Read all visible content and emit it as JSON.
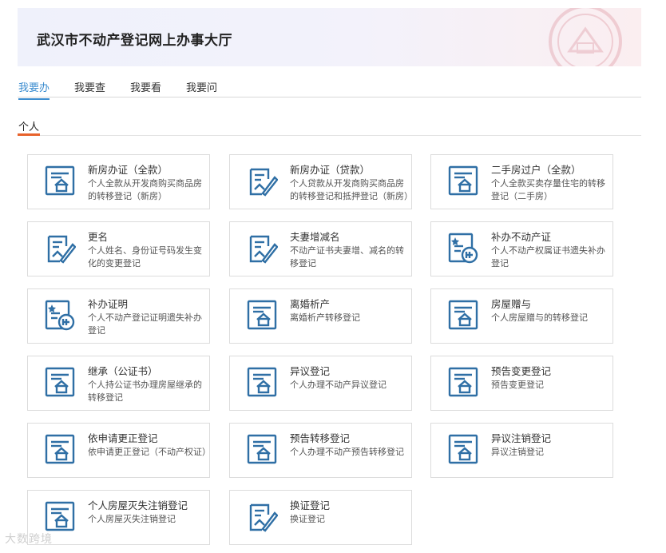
{
  "header": {
    "title": "武汉市不动产登记网上办事大厅"
  },
  "tabs": [
    {
      "label": "我要办",
      "active": true
    },
    {
      "label": "我要查",
      "active": false
    },
    {
      "label": "我要看",
      "active": false
    },
    {
      "label": "我要问",
      "active": false
    }
  ],
  "section": {
    "title": "个人"
  },
  "cards": [
    {
      "title": "新房办证（全款）",
      "desc": "个人全款从开发商购买商品房的转移登记（新房）",
      "icon": "house-doc-icon"
    },
    {
      "title": "新房办证（贷款）",
      "desc": "个人贷款从开发商购买商品房的转移登记和抵押登记（新房）",
      "icon": "doc-edit-icon"
    },
    {
      "title": "二手房过户（全款）",
      "desc": "个人全款买卖存量住宅的转移登记（二手房）",
      "icon": "house-doc-icon"
    },
    {
      "title": "更名",
      "desc": "个人姓名、身份证号码发生变化的变更登记",
      "icon": "doc-edit-icon"
    },
    {
      "title": "夫妻增减名",
      "desc": "不动产证书夫妻增、减名的转移登记",
      "icon": "doc-edit-icon"
    },
    {
      "title": "补办不动产证",
      "desc": "个人不动产权属证书遗失补办登记",
      "icon": "doc-reissue-icon"
    },
    {
      "title": "补办证明",
      "desc": "个人不动产登记证明遗失补办登记",
      "icon": "doc-reissue-icon"
    },
    {
      "title": "离婚析产",
      "desc": "离婚析产转移登记",
      "icon": "house-doc-icon"
    },
    {
      "title": "房屋赠与",
      "desc": "个人房屋赠与的转移登记",
      "icon": "house-doc-icon"
    },
    {
      "title": "继承（公证书）",
      "desc": "个人持公证书办理房屋继承的转移登记",
      "icon": "house-doc-icon"
    },
    {
      "title": "异议登记",
      "desc": "个人办理不动产异议登记",
      "icon": "house-doc-icon"
    },
    {
      "title": "预告变更登记",
      "desc": "预告变更登记",
      "icon": "house-doc-icon"
    },
    {
      "title": "依申请更正登记",
      "desc": "依申请更正登记（不动产权证）",
      "icon": "house-doc-icon"
    },
    {
      "title": "预告转移登记",
      "desc": "个人办理不动产预告转移登记",
      "icon": "house-doc-icon"
    },
    {
      "title": "异议注销登记",
      "desc": "异议注销登记",
      "icon": "house-doc-icon"
    },
    {
      "title": "个人房屋灭失注销登记",
      "desc": "个人房屋灭失注销登记",
      "icon": "house-doc-icon"
    },
    {
      "title": "换证登记",
      "desc": "换证登记",
      "icon": "doc-edit-icon"
    }
  ],
  "watermark": "大数跨境",
  "colors": {
    "accent": "#3b8ccf",
    "icon": "#2f6fa5",
    "section_marker": "#e8632c"
  }
}
